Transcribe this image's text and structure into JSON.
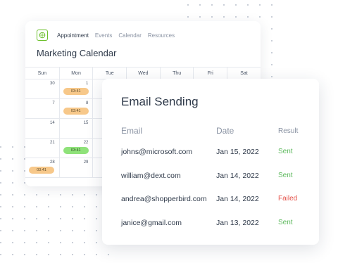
{
  "calendar": {
    "nav": [
      "Appointment",
      "Events",
      "Calendar",
      "Resources"
    ],
    "title": "Marketing Calendar",
    "days_of_week": [
      "Sun",
      "Mon",
      "Tue",
      "Wed",
      "Thu",
      "Fri",
      "Sat"
    ],
    "weeks": [
      [
        {
          "day": "30"
        },
        {
          "day": "1",
          "event": "03:41",
          "color": "orange"
        },
        {},
        {},
        {},
        {},
        {}
      ],
      [
        {
          "day": "7"
        },
        {
          "day": "8",
          "event": "03:41",
          "color": "orange"
        },
        {},
        {},
        {},
        {},
        {}
      ],
      [
        {
          "day": "14"
        },
        {
          "day": "15"
        },
        {},
        {},
        {},
        {},
        {}
      ],
      [
        {
          "day": "21"
        },
        {
          "day": "22",
          "event": "03:41",
          "color": "green"
        },
        {},
        {},
        {},
        {},
        {}
      ],
      [
        {
          "day": "28",
          "event": "03:41",
          "color": "orange"
        },
        {
          "day": "29"
        },
        {},
        {},
        {},
        {},
        {}
      ]
    ],
    "accent_color": "#6bbf2a"
  },
  "email_sending": {
    "title": "Email Sending",
    "headers": {
      "email": "Email",
      "date": "Date",
      "result": "Result"
    },
    "rows": [
      {
        "email": "johns@microsoft.com",
        "date": "Jan 15, 2022",
        "result": "Sent",
        "status": "sent"
      },
      {
        "email": "william@dext.com",
        "date": "Jan 14, 2022",
        "result": "Sent",
        "status": "sent"
      },
      {
        "email": "andrea@shopperbird.com",
        "date": "Jan 14, 2022",
        "result": "Failed",
        "status": "failed"
      },
      {
        "email": "janice@gmail.com",
        "date": "Jan 13, 2022",
        "result": "Sent",
        "status": "sent"
      }
    ],
    "colors": {
      "sent": "#5cb85c",
      "failed": "#e5534b"
    }
  }
}
